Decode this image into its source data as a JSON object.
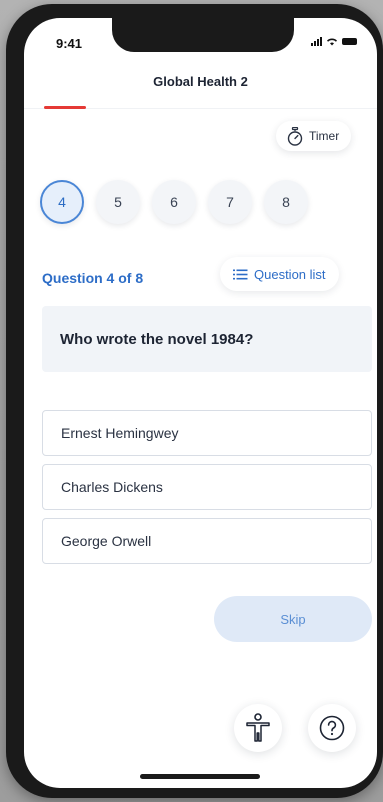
{
  "status_bar": {
    "time": "9:41"
  },
  "header": {
    "title": "Global Health 2"
  },
  "timer": {
    "label": "Timer",
    "icon": "stopwatch-icon"
  },
  "question_numbers": [
    {
      "label": "4",
      "active": true
    },
    {
      "label": "5",
      "active": false
    },
    {
      "label": "6",
      "active": false
    },
    {
      "label": "7",
      "active": false
    },
    {
      "label": "8",
      "active": false
    }
  ],
  "question_counter": "Question 4 of 8",
  "question_list": {
    "label": "Question list",
    "icon": "list-icon"
  },
  "question": {
    "text": "Who wrote the novel 1984?"
  },
  "answers": [
    {
      "label": "Ernest Hemingwey"
    },
    {
      "label": "Charles Dickens"
    },
    {
      "label": "George Orwell"
    }
  ],
  "skip": {
    "label": "Skip"
  },
  "bottom_actions": {
    "accessibility_icon": "accessibility-icon",
    "help_icon": "help-icon"
  },
  "colors": {
    "accent_blue": "#2d6dc7",
    "header_underline": "#e53935",
    "skip_bg": "#dfe9f7"
  }
}
